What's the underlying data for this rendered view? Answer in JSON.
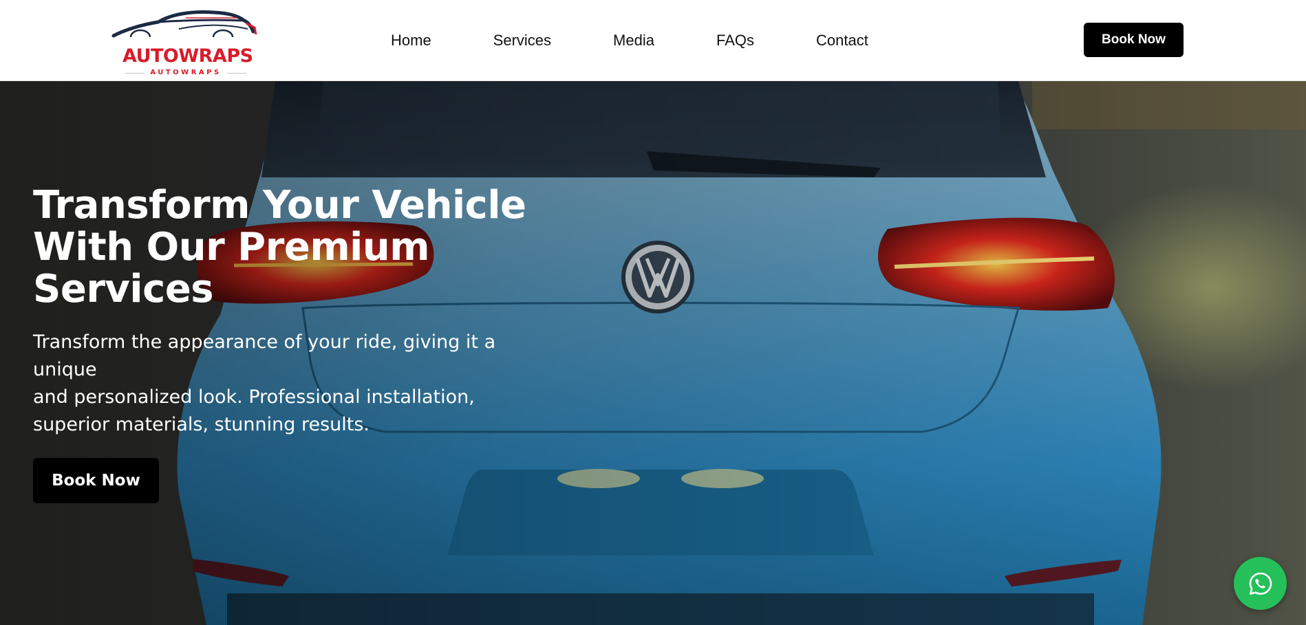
{
  "header": {
    "logo": {
      "wordmark": "AUTOWRAPS",
      "subtext": "AUTOWRAPS",
      "icon": "car-silhouette-logo"
    },
    "nav": [
      {
        "label": "Home"
      },
      {
        "label": "Services"
      },
      {
        "label": "Media"
      },
      {
        "label": "FAQs"
      },
      {
        "label": "Contact"
      }
    ],
    "cta_label": "Book Now"
  },
  "hero": {
    "title_lines": [
      "Transform Your Vehicle",
      "With Our Premium",
      "Services"
    ],
    "description_lines": [
      "Transform the appearance of your ride, giving it a unique",
      "and personalized look. Professional installation,",
      "superior materials, stunning results."
    ],
    "cta_label": "Book Now",
    "background_image": "blue Volkswagen hatchback rear view at night"
  },
  "floating": {
    "whatsapp_icon": "whatsapp-icon"
  },
  "colors": {
    "brand_red": "#d81c2a",
    "button_black": "#000000",
    "whatsapp_green": "#25c05a",
    "car_blue": "#3d9fd0"
  }
}
